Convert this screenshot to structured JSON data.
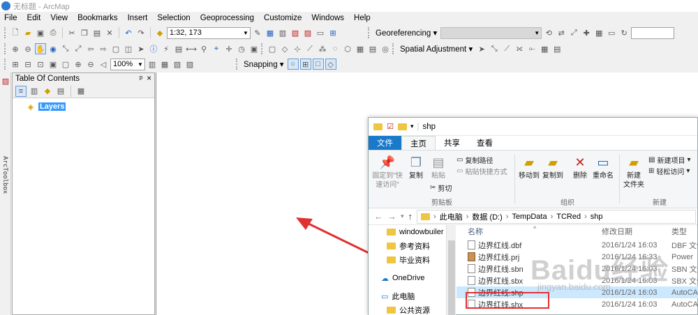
{
  "window": {
    "title": "无标题 - ArcMap"
  },
  "menu": [
    "File",
    "Edit",
    "View",
    "Bookmarks",
    "Insert",
    "Selection",
    "Geoprocessing",
    "Customize",
    "Windows",
    "Help"
  ],
  "toolbar": {
    "scale": "1:32, 173",
    "georef_label": "Georeferencing",
    "zoom": "100%",
    "spatial_label": "Spatial Adjustment",
    "snapping_label": "Snapping"
  },
  "toc": {
    "title": "Table Of Contents",
    "pin": "ᵖ",
    "close": "×",
    "layers_label": "Layers",
    "arctoolbox": "ArcToolbox"
  },
  "explorer": {
    "title": "shp",
    "tabs": [
      "文件",
      "主页",
      "共享",
      "查看"
    ],
    "ribbon": {
      "pin_quick": "固定到\"快速访问\"",
      "copy": "复制",
      "paste": "粘贴",
      "copy_path": "复制路径",
      "paste_shortcut": "粘贴快捷方式",
      "cut": "剪切",
      "clipboard": "剪贴板",
      "move_to": "移动到",
      "copy_to": "复制到",
      "delete": "删除",
      "rename": "重命名",
      "organize": "组织",
      "new_folder": "新建\n文件夹",
      "new_item": "新建项目",
      "easy_access": "轻松访问",
      "new_group": "新建"
    },
    "breadcrumb": [
      "此电脑",
      "数据 (D:)",
      "TempData",
      "TCRed",
      "shp"
    ],
    "nav": [
      "windowbuiler",
      "参考资料",
      "毕业资料",
      "OneDrive",
      "此电脑",
      "公共资源"
    ],
    "columns": {
      "name": "名称",
      "date": "修改日期",
      "type": "类型"
    },
    "files": [
      {
        "name": "边界红线.dbf",
        "date": "2016/1/24 16:03",
        "type": "DBF 文件"
      },
      {
        "name": "边界红线.prj",
        "date": "2016/1/24 16:33",
        "type": "Power"
      },
      {
        "name": "边界红线.sbn",
        "date": "2016/1/24 16:03",
        "type": "SBN 文件"
      },
      {
        "name": "边界红线.sbx",
        "date": "2016/1/24 16:03",
        "type": "SBX 文件"
      },
      {
        "name": "边界红线.shp",
        "date": "2016/1/24 16:03",
        "type": "AutoCAD"
      },
      {
        "name": "边界红线.shx",
        "date": "2016/1/24 16:03",
        "type": "AutoCAD"
      }
    ]
  },
  "watermark": {
    "text": "Baidu经验",
    "url": "jingyan.baidu.com"
  },
  "colors": {
    "arrow": "#e03030",
    "highlight_box": "#e03030",
    "file_tab": "#1979ca",
    "layers_highlight": "#3399ff"
  }
}
